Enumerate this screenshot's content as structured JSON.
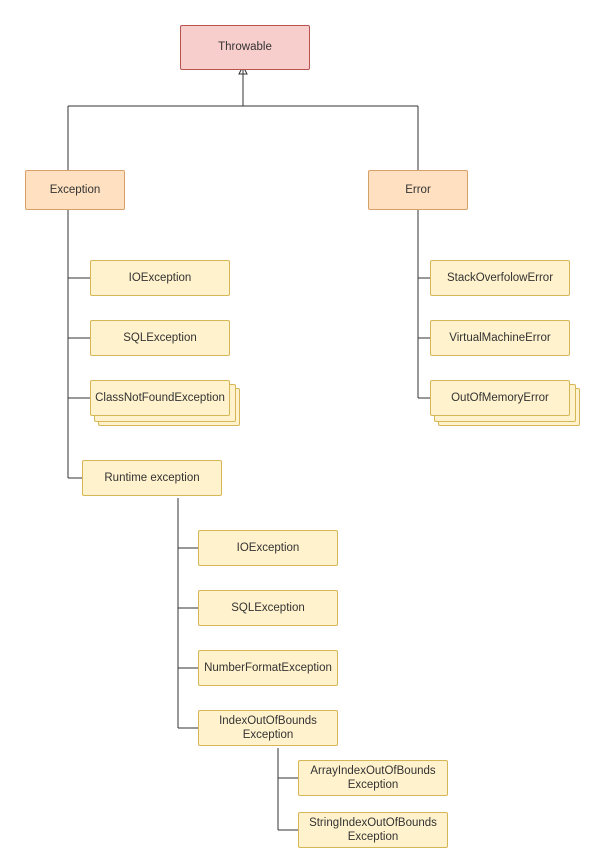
{
  "chart_data": {
    "type": "tree",
    "nodes": [
      {
        "id": "throwable",
        "label": "Throwable",
        "parent": null
      },
      {
        "id": "exception",
        "label": "Exception",
        "parent": "throwable"
      },
      {
        "id": "error",
        "label": "Error",
        "parent": "throwable"
      },
      {
        "id": "ioexception",
        "label": "IOException",
        "parent": "exception"
      },
      {
        "id": "sqlexception",
        "label": "SQLException",
        "parent": "exception"
      },
      {
        "id": "classnotfound",
        "label": "ClassNotFoundException",
        "parent": "exception"
      },
      {
        "id": "runtime",
        "label": "Runtime exception",
        "parent": "exception"
      },
      {
        "id": "stackoverflow",
        "label": "StackOverfolowError",
        "parent": "error"
      },
      {
        "id": "virtualmachine",
        "label": "VirtualMachineError",
        "parent": "error"
      },
      {
        "id": "outofmemory",
        "label": "OutOfMemoryError",
        "parent": "error"
      },
      {
        "id": "r_ioexception",
        "label": "IOException",
        "parent": "runtime"
      },
      {
        "id": "r_sqlexception",
        "label": "SQLException",
        "parent": "runtime"
      },
      {
        "id": "numberformat",
        "label": "NumberFormatException",
        "parent": "runtime"
      },
      {
        "id": "indexoob",
        "label": "IndexOutOfBounds\nException",
        "parent": "runtime"
      },
      {
        "id": "arrayoob",
        "label": "ArrayIndexOutOfBounds\nException",
        "parent": "indexoob"
      },
      {
        "id": "stringoob",
        "label": "StringIndexOutOfBounds\nException",
        "parent": "indexoob"
      }
    ]
  },
  "labels": {
    "throwable": "Throwable",
    "exception": "Exception",
    "error": "Error",
    "ioexception": "IOException",
    "sqlexception": "SQLException",
    "classnotfound": "ClassNotFoundException",
    "runtime": "Runtime exception",
    "stackoverflow": "StackOverfolowError",
    "virtualmachine": "VirtualMachineError",
    "outofmemory": "OutOfMemoryError",
    "r_ioexception": "IOException",
    "r_sqlexception": "SQLException",
    "numberformat": "NumberFormatException",
    "indexoob": "IndexOutOfBounds Exception",
    "arrayoob": "ArrayIndexOutOfBounds Exception",
    "stringoob": "StringIndexOutOfBounds Exception"
  }
}
